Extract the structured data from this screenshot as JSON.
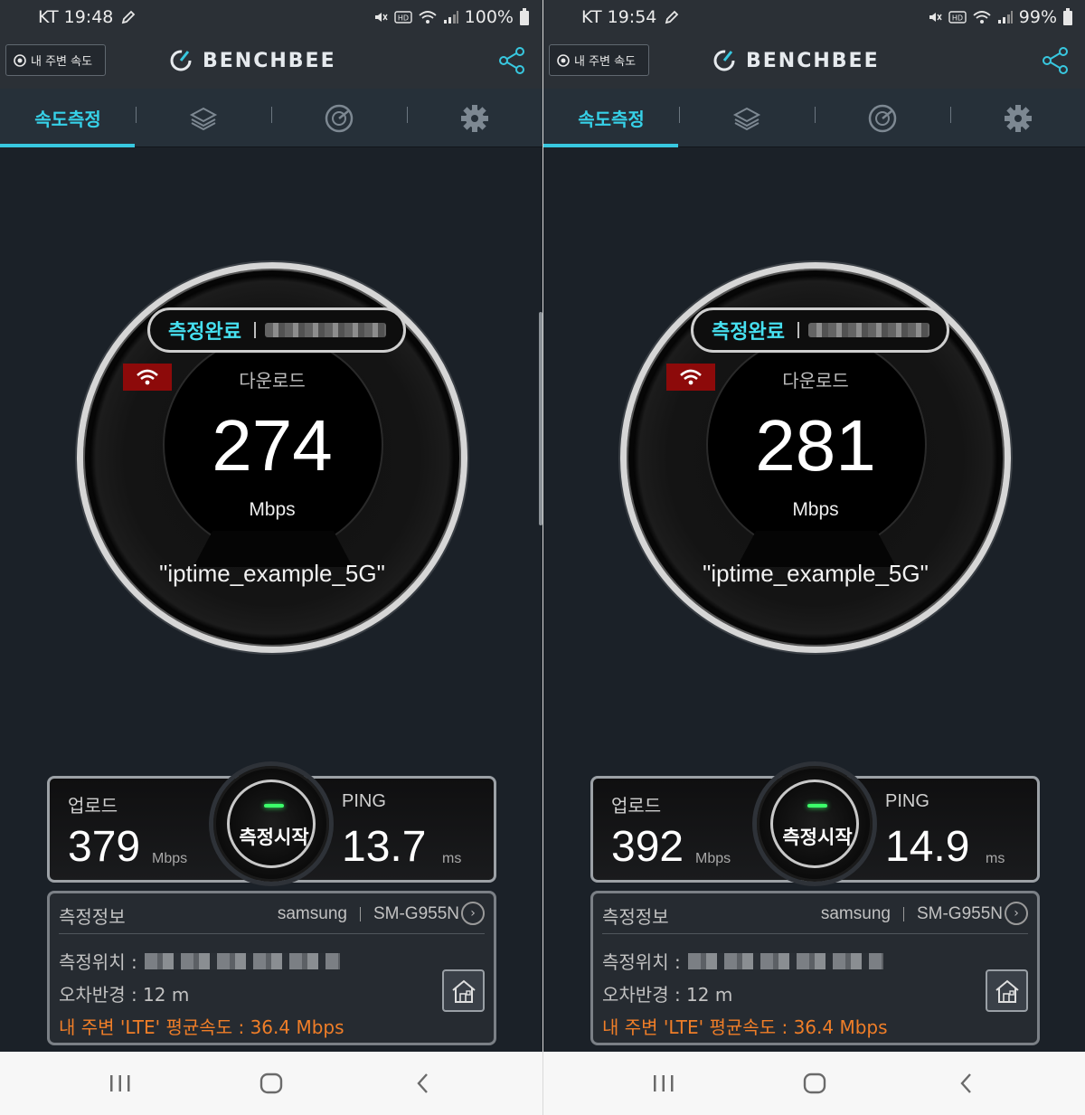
{
  "screens": [
    {
      "status_bar": {
        "carrier_time": "KT 19:48",
        "battery": "100%"
      },
      "header": {
        "nearby_button": "내 주변 속도",
        "logo": "BENCHBEE"
      },
      "tabs": [
        {
          "label": "속도측정"
        }
      ],
      "gauge": {
        "status": "측정완료",
        "title": "다운로드",
        "value": "274",
        "unit": "Mbps",
        "ssid": "\"iptime_example_5G\""
      },
      "stats": {
        "upload_label": "업로드",
        "upload_value": "379",
        "upload_unit": "Mbps",
        "start_label": "측정시작",
        "ping_label": "PING",
        "ping_value": "13.7",
        "ping_unit": "ms"
      },
      "info": {
        "title": "측정정보",
        "vendor": "samsung",
        "model": "SM-G955N",
        "location_label": "측정위치 :",
        "error_radius": "오차반경 : 12 m",
        "avg_speed": "내 주변 'LTE' 평균속도 :  36.4 Mbps"
      }
    },
    {
      "status_bar": {
        "carrier_time": "KT 19:54",
        "battery": "99%"
      },
      "header": {
        "nearby_button": "내 주변 속도",
        "logo": "BENCHBEE"
      },
      "tabs": [
        {
          "label": "속도측정"
        }
      ],
      "gauge": {
        "status": "측정완료",
        "title": "다운로드",
        "value": "281",
        "unit": "Mbps",
        "ssid": "\"iptime_example_5G\""
      },
      "stats": {
        "upload_label": "업로드",
        "upload_value": "392",
        "upload_unit": "Mbps",
        "start_label": "측정시작",
        "ping_label": "PING",
        "ping_value": "14.9",
        "ping_unit": "ms"
      },
      "info": {
        "title": "측정정보",
        "vendor": "samsung",
        "model": "SM-G955N",
        "location_label": "측정위치 :",
        "error_radius": "오차반경 : 12 m",
        "avg_speed": "내 주변 'LTE' 평균속도 :  36.4 Mbps"
      }
    }
  ],
  "icons": {
    "tab_icons": [
      "layers-icon",
      "gauge-icon",
      "gear-icon"
    ],
    "nav_icons": [
      "recent-apps-icon",
      "home-icon",
      "back-icon"
    ]
  },
  "colors": {
    "accent": "#38c8e0",
    "orange": "#f07e28",
    "wifi_badge": "#8d0a0a"
  }
}
